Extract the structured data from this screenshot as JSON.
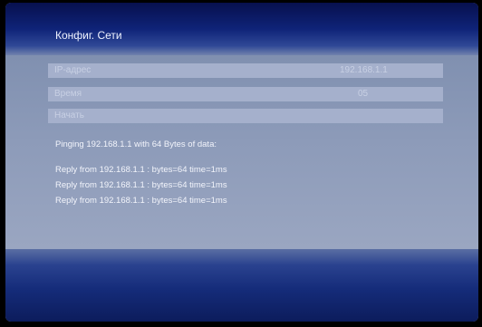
{
  "window": {
    "title": "Конфиг. Сети"
  },
  "fields": [
    {
      "label": "IP-адрес",
      "value": "192.168.1.1"
    },
    {
      "label": "Время",
      "value": "05"
    },
    {
      "label": "Начать",
      "value": ""
    }
  ],
  "output": {
    "header": "Pinging 192.168.1.1 with 64 Bytes of data:",
    "replies": [
      "Reply from 192.168.1.1 : bytes=64 time=1ms",
      "Reply from 192.168.1.1 : bytes=64 time=1ms",
      "Reply from 192.168.1.1 : bytes=64 time=1ms"
    ]
  }
}
